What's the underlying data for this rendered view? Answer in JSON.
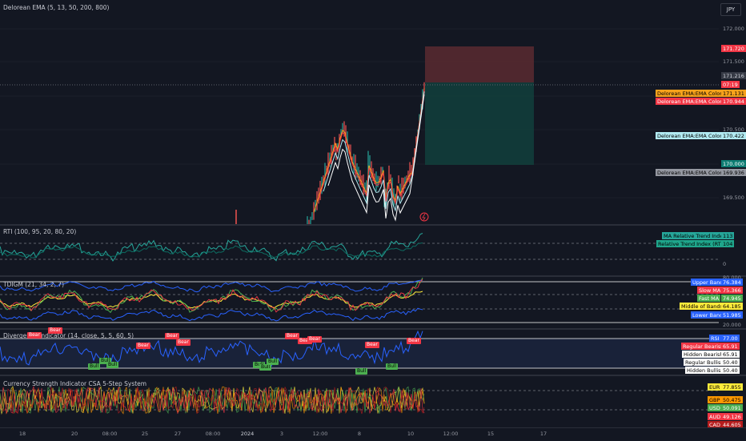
{
  "main": {
    "title": "Delorean EMA (5, 13, 50, 200, 800)",
    "currency_button": "JPY",
    "price_ticks": [
      "172.000",
      "171.500",
      "170.500",
      "169.500"
    ],
    "sl_price": "171.720",
    "last_price": "171.216",
    "countdown": "07:19",
    "ema_tags": [
      {
        "label": "Delorean EMA:EMA Color 1",
        "value": "171.131",
        "color": "#f7a21b",
        "text": "#000000"
      },
      {
        "label": "Delorean EMA:EMA Color 2",
        "value": "170.944",
        "color": "#f23645",
        "text": "#ffffff"
      },
      {
        "label": "Delorean EMA:EMA Color 3",
        "value": "170.422",
        "color": "#b2ebf2",
        "text": "#000000"
      },
      {
        "label": "Delorean EMA:EMA Color 4",
        "value": "169.936",
        "color": "#9598a1",
        "text": "#000000"
      }
    ],
    "target_price": "170.000"
  },
  "rti": {
    "title": "RTI (100, 95, 20, 80, 20)",
    "tags": [
      {
        "label": "MA Relative Trend Index",
        "value": "113",
        "color": "#26a69a"
      },
      {
        "label": "Relative Trend Index (RTI)",
        "value": "104",
        "color": "#1fa68c"
      }
    ],
    "zero": "0"
  },
  "tdi": {
    "title": "TDIGM (21, 34, 2, 7)",
    "tags": [
      {
        "label": "Upper Band",
        "value": "76.384",
        "color": "#2962ff",
        "text": "#ffffff"
      },
      {
        "label": "Slow MA",
        "value": "75.366",
        "color": "#f23645",
        "text": "#ffffff"
      },
      {
        "label": "Fast MA",
        "value": "74.945",
        "color": "#4caf50",
        "text": "#ffffff"
      },
      {
        "label": "Middle of Bands",
        "value": "64.185",
        "color": "#ffeb3b",
        "text": "#000000"
      },
      {
        "label": "Lower Band",
        "value": "51.985",
        "color": "#2962ff",
        "text": "#ffffff"
      }
    ],
    "ticks": [
      "80.000",
      "20.000"
    ]
  },
  "div": {
    "title": "Divergence Indicator (14, close, 5, 5, 60, 5)",
    "tags": [
      {
        "label": "RSI",
        "value": "77.00",
        "color": "#2962ff",
        "text": "#ffffff"
      },
      {
        "label": "Regular Bearish",
        "value": "65.91",
        "color": "#f23645",
        "text": "#ffffff"
      },
      {
        "label": "Hidden Bearish",
        "value": "65.91",
        "color": "#ffffff",
        "text": "#000000"
      },
      {
        "label": "Regular Bullish",
        "value": "50.40",
        "color": "#ffffff",
        "text": "#000000"
      },
      {
        "label": "Hidden Bullish",
        "value": "50.40",
        "color": "#ffffff",
        "text": "#000000"
      }
    ],
    "bear_label": "Bear",
    "bull_label": "Bull"
  },
  "csi": {
    "title": "Currency Strength Indicator CSA 5-Step System",
    "tags": [
      {
        "label": "EUR",
        "value": "77.855",
        "color": "#ffeb3b",
        "text": "#000000"
      },
      {
        "label": "GBP",
        "value": "50.475",
        "color": "#ff9800",
        "text": "#000000"
      },
      {
        "label": "USD",
        "value": "50.091",
        "color": "#4caf50",
        "text": "#ffffff"
      },
      {
        "label": "AUD",
        "value": "49.126",
        "color": "#f23645",
        "text": "#ffffff"
      },
      {
        "label": "CAD",
        "value": "44.605",
        "color": "#b71c1c",
        "text": "#ffffff"
      }
    ]
  },
  "x_axis": [
    "18",
    "20",
    "08:00",
    "25",
    "27",
    "08:00",
    "2024",
    "3",
    "12:00",
    "8",
    "10",
    "12:00",
    "15",
    "17"
  ],
  "colors": {
    "background": "#131722",
    "grid": "#1e222d",
    "bull": "#26a69a",
    "bear": "#ef5350",
    "stop_zone": "#5b2a30",
    "target_zone": "#123d3b",
    "rsi_line": "#2962ff"
  }
}
